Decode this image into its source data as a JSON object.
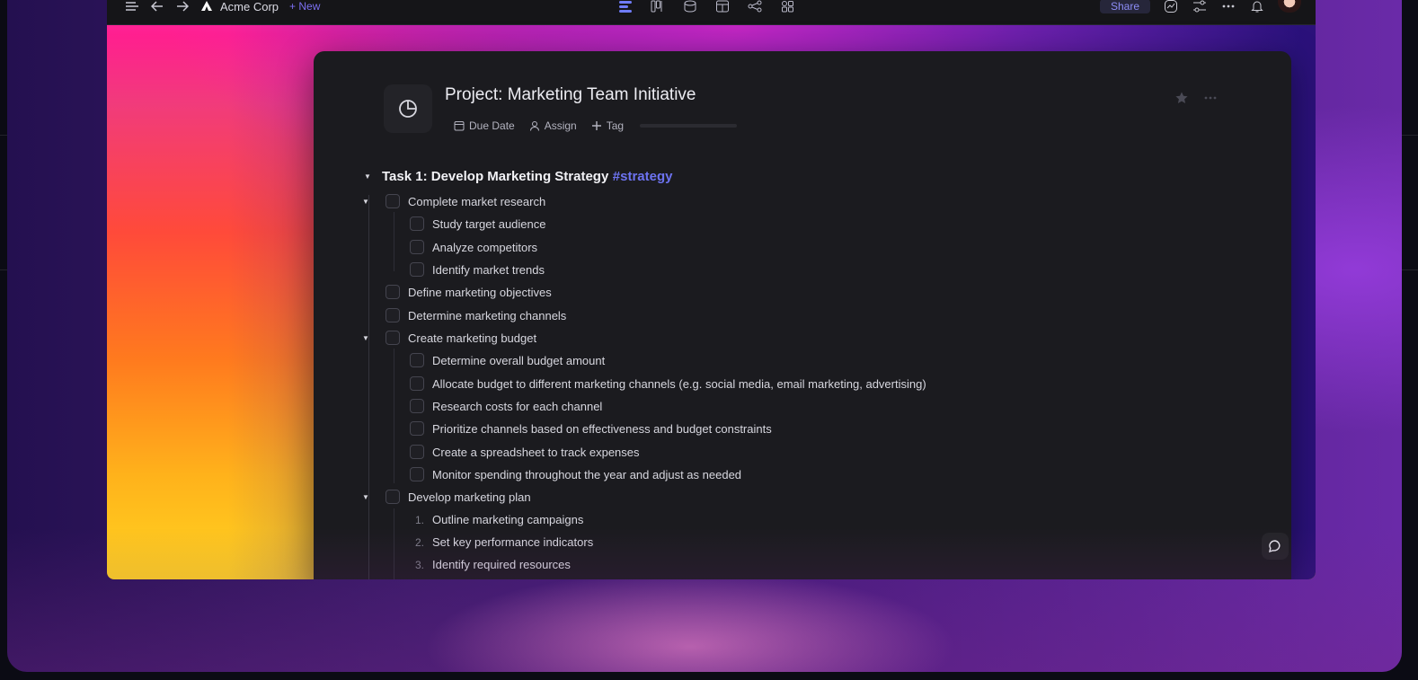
{
  "topbar": {
    "workspace_name": "Acme Corp",
    "new_label": "+ New",
    "share_label": "Share",
    "view_icons": [
      "list-view-icon",
      "board-view-icon",
      "database-icon",
      "table-view-icon",
      "graph-view-icon",
      "apps-icon"
    ]
  },
  "document": {
    "title": "Project: Marketing Team Initiative",
    "meta": {
      "due_date_label": "Due Date",
      "assign_label": "Assign",
      "tag_label": "Tag"
    },
    "task_heading": "Task 1: Develop Marketing Strategy",
    "task_tag": "#strategy",
    "items": [
      {
        "label": "Complete market research",
        "level": 1,
        "type": "checkbox",
        "expanded": true
      },
      {
        "label": "Study target audience",
        "level": 2,
        "type": "checkbox"
      },
      {
        "label": "Analyze competitors",
        "level": 2,
        "type": "checkbox"
      },
      {
        "label": "Identify market trends",
        "level": 2,
        "type": "checkbox"
      },
      {
        "label": "Define marketing objectives",
        "level": 1,
        "type": "checkbox"
      },
      {
        "label": "Determine marketing channels",
        "level": 1,
        "type": "checkbox"
      },
      {
        "label": "Create marketing budget",
        "level": 1,
        "type": "checkbox",
        "expanded": true
      },
      {
        "label": "Determine overall budget amount",
        "level": 2,
        "type": "checkbox"
      },
      {
        "label": "Allocate budget to different marketing channels (e.g. social media, email marketing, advertising)",
        "level": 2,
        "type": "checkbox"
      },
      {
        "label": "Research costs for each channel",
        "level": 2,
        "type": "checkbox"
      },
      {
        "label": "Prioritize channels based on effectiveness and budget constraints",
        "level": 2,
        "type": "checkbox"
      },
      {
        "label": "Create a spreadsheet to track expenses",
        "level": 2,
        "type": "checkbox"
      },
      {
        "label": "Monitor spending throughout the year and adjust as needed",
        "level": 2,
        "type": "checkbox"
      },
      {
        "label": "Develop marketing plan",
        "level": 1,
        "type": "checkbox",
        "expanded": true
      },
      {
        "label": "Outline marketing campaigns",
        "level": 2,
        "type": "numbered",
        "number": "1."
      },
      {
        "label": "Set key performance indicators",
        "level": 2,
        "type": "numbered",
        "number": "2."
      },
      {
        "label": "Identify required resources",
        "level": 2,
        "type": "numbered",
        "number": "3."
      }
    ]
  },
  "colors": {
    "accent": "#6d73f0",
    "doc_background": "#1b1b1f",
    "text_primary": "#d7d7df"
  }
}
